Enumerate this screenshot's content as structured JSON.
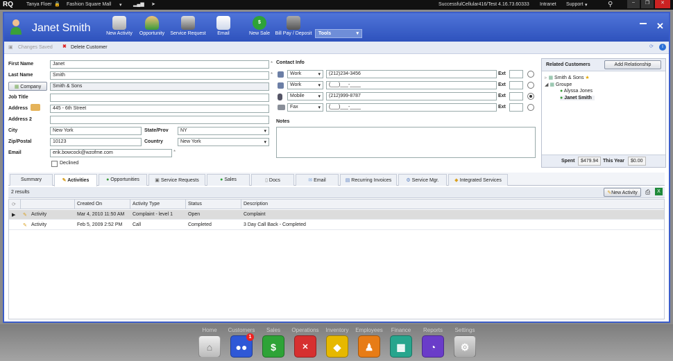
{
  "topbar": {
    "logo": "RQ",
    "user": "Tanya Floer",
    "store": "Fashion Square Mall",
    "server": "SuccessfulCellular416/Test 4.16.73.60333",
    "intranet": "Intranet",
    "support": "Support"
  },
  "header": {
    "customer_name": "Janet Smith",
    "buttons": [
      "New Activity",
      "Opportunity",
      "Service Request",
      "Email",
      "New Sale",
      "Bill Pay / Deposit"
    ],
    "tools_label": "Tools"
  },
  "actionbar": {
    "changes_saved": "Changes Saved",
    "delete_customer": "Delete Customer"
  },
  "form": {
    "labels": {
      "first_name": "First Name",
      "last_name": "Last Name",
      "company": "Company",
      "job_title": "Job Title",
      "address": "Address",
      "address2": "Address 2",
      "city": "City",
      "state": "State/Prov",
      "zip": "Zip/Postal",
      "country": "Country",
      "email": "Email",
      "declined": "Declined"
    },
    "values": {
      "first_name": "Janet",
      "last_name": "Smith",
      "company": "Smith & Sons",
      "job_title": "",
      "address": "445 - 6th Street",
      "address2": "",
      "city": "New York",
      "state": "NY",
      "zip": "10123",
      "country": "New York",
      "email": "erik.bowcock@wzofme.com"
    }
  },
  "contact": {
    "title": "Contact Info",
    "ext_label": "Ext",
    "rows": [
      {
        "type": "Work",
        "number": "(212)234-3456"
      },
      {
        "type": "Work",
        "number": "(___)___-____"
      },
      {
        "type": "Mobile",
        "number": "(212)999-8787"
      },
      {
        "type": "Fax",
        "number": "(___)___-____"
      }
    ],
    "notes_label": "Notes"
  },
  "related": {
    "title": "Related Customers",
    "add_button": "Add Relationship",
    "tree": [
      "Smith & Sons",
      "Groupe",
      "Alyssa Jones",
      "Janet Smith"
    ],
    "spent_label": "Spent",
    "spent_value": "$479.94",
    "this_year_label": "This Year",
    "this_year_value": "$0.00"
  },
  "tabs": [
    "Summary",
    "Activities",
    "Opportunities",
    "Service Requests",
    "Sales",
    "Docs",
    "Email",
    "Recurring Invoices",
    "Service Mgr.",
    "Integrated Services"
  ],
  "results": {
    "count_label": "2 results",
    "new_activity": "New Activity"
  },
  "grid": {
    "columns": [
      "Created On",
      "Activity Type",
      "Status",
      "Description"
    ],
    "rows": [
      {
        "name": "Activity",
        "created": "Mar 4, 2010 11:50 AM",
        "type": "Complaint - level 1",
        "status": "Open",
        "description": "Complaint"
      },
      {
        "name": "Activity",
        "created": "Feb 5, 2009 2:52 PM",
        "type": "Call",
        "status": "Completed",
        "description": "3 Day Call Back - Completed"
      }
    ]
  },
  "dock": {
    "items": [
      "Home",
      "Customers",
      "Sales",
      "Operations",
      "Inventory",
      "Employees",
      "Finance",
      "Reports",
      "Settings"
    ],
    "customers_badge": "1",
    "colors": [
      "#d8d8d8",
      "#2f58d6",
      "#2ea337",
      "#d63030",
      "#e6b800",
      "#e77c16",
      "#27a58d",
      "#6a3cc9",
      "#cfcfcf"
    ]
  }
}
